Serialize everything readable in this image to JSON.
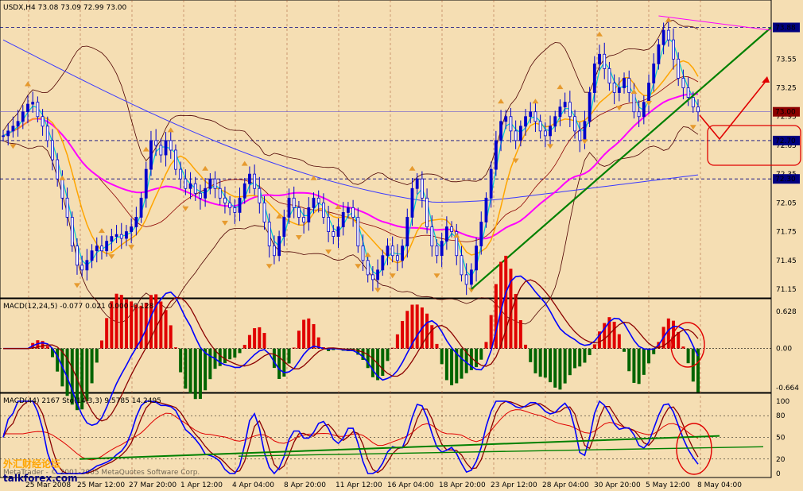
{
  "header": {
    "main": "USDX,H4  73.08 73.09 72.99 73.00",
    "macd": "MACD(12,24,5) -0.077 0.021 0.000 -0.128",
    "stoch": "MACD(44) 2167  Sto(14,3,3) 9.5785 14.2495"
  },
  "watermark": {
    "cjk": "外汇财经论坛",
    "site": "talkforex.com",
    "copyright": "MetaTrader - © 2001-2005 MetaQuotes Software Corp."
  },
  "colors": {
    "background": "#f5deb3",
    "candle_up": "#0000cc",
    "candle_down": "#0000cc",
    "trendline": "#008000",
    "bollinger": "#4d0000",
    "ma_fast": "#00ced1",
    "ma_orange": "#ffa500",
    "ma_magenta": "#ff00ff",
    "ma_slow_blue": "#3a3aff",
    "ma_brown": "#8b0000",
    "highlight_red": "#e00000",
    "fractal": "#e69a2e",
    "macd_pos": "#e00000",
    "macd_neg": "#006400"
  },
  "chart_data": [
    {
      "type": "candlestick",
      "title": "USDX,H4",
      "symbol": "USDX",
      "timeframe": "H4",
      "ohlc_last": {
        "open": 73.08,
        "high": 73.09,
        "low": 72.99,
        "close": 73.0
      },
      "x_ticks": [
        "25 Mar 2008",
        "25 Mar 12:00",
        "27 Mar 20:00",
        "1 Apr 12:00",
        "4 Apr 04:00",
        "8 Apr 20:00",
        "11 Apr 12:00",
        "16 Apr 04:00",
        "18 Apr 20:00",
        "23 Apr 12:00",
        "28 Apr 04:00",
        "30 Apr 20:00",
        "5 May 12:00",
        "8 May 04:00"
      ],
      "y_ticks": [
        73.88,
        73.55,
        73.25,
        72.95,
        72.65,
        72.35,
        72.05,
        71.75,
        71.45,
        71.15
      ],
      "y_marker_labels": [
        "73.88",
        "73.00",
        "72.70",
        "72.30"
      ],
      "ylim": [
        71.1,
        74.05
      ],
      "close_series": [
        72.75,
        72.8,
        72.85,
        72.9,
        73.0,
        73.08,
        73.1,
        72.95,
        72.85,
        72.7,
        72.5,
        72.3,
        72.1,
        71.9,
        71.6,
        71.4,
        71.35,
        71.45,
        71.55,
        71.6,
        71.55,
        71.65,
        71.7,
        71.72,
        71.68,
        71.75,
        71.8,
        71.9,
        72.1,
        72.4,
        72.7,
        72.65,
        72.55,
        72.7,
        72.6,
        72.4,
        72.3,
        72.2,
        72.25,
        72.15,
        72.1,
        72.2,
        72.3,
        72.2,
        72.1,
        72.05,
        72.0,
        71.95,
        72.1,
        72.25,
        72.35,
        72.2,
        72.05,
        71.85,
        71.6,
        71.5,
        71.7,
        71.9,
        72.1,
        72.0,
        71.9,
        71.85,
        72.0,
        72.1,
        72.05,
        71.9,
        71.75,
        71.7,
        71.8,
        71.95,
        72.0,
        71.9,
        71.6,
        71.45,
        71.3,
        71.25,
        71.35,
        71.5,
        71.6,
        71.5,
        71.45,
        71.6,
        71.9,
        72.2,
        72.3,
        72.1,
        71.8,
        71.6,
        71.5,
        71.65,
        71.8,
        71.75,
        71.5,
        71.3,
        71.2,
        71.35,
        71.6,
        71.85,
        72.1,
        72.4,
        72.7,
        72.9,
        72.95,
        72.8,
        72.7,
        72.85,
        72.95,
        73.0,
        72.9,
        72.8,
        72.75,
        72.85,
        72.95,
        73.05,
        73.1,
        72.95,
        72.8,
        72.7,
        72.9,
        73.2,
        73.5,
        73.6,
        73.45,
        73.3,
        73.2,
        73.25,
        73.35,
        73.2,
        73.0,
        72.95,
        73.1,
        73.3,
        73.5,
        73.7,
        73.85,
        73.75,
        73.55,
        73.35,
        73.25,
        73.15,
        73.05,
        73.0
      ],
      "fractals_up_idx": [
        5,
        12,
        20,
        29,
        34,
        41,
        49,
        56,
        63,
        68,
        74,
        83,
        92,
        101,
        108,
        113,
        121,
        128,
        135
      ],
      "fractals_down_idx": [
        2,
        15,
        22,
        26,
        37,
        45,
        54,
        60,
        66,
        72,
        76,
        79,
        88,
        95,
        104,
        111,
        118,
        125,
        131,
        140
      ],
      "trendline": {
        "from": [
          95,
          71.15
        ],
        "to": [
          143,
          73.88
        ]
      },
      "horizontal_levels": [
        73.88,
        73.0,
        72.7,
        72.3
      ],
      "annotation": "red projection arrow: decline toward 72.70 then rally toward 73.25+"
    },
    {
      "type": "bar",
      "title": "MACD(12,24,5) -0.077 0.021 0.000 -0.128",
      "y_ticks": [
        0.628,
        0.0,
        -0.664
      ],
      "ylim": [
        -0.664,
        0.628
      ],
      "histogram_sign_note": "red = positive, green = negative"
    },
    {
      "type": "line",
      "title": "Sto(14,3,3) 9.5785 14.2495",
      "y_ticks": [
        100,
        80,
        50,
        20,
        0
      ],
      "ylim": [
        0,
        100
      ]
    }
  ]
}
